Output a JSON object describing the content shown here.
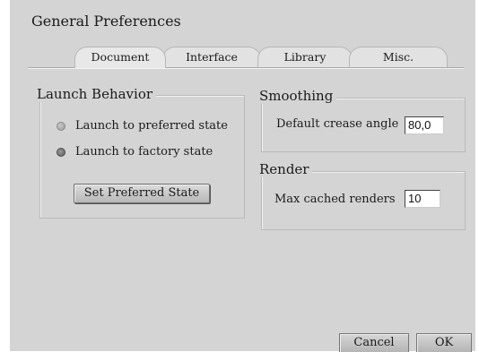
{
  "dialog": {
    "title": "General Preferences"
  },
  "tabs": [
    {
      "label": "Document",
      "active": true
    },
    {
      "label": "Interface",
      "active": false
    },
    {
      "label": "Library",
      "active": false
    },
    {
      "label": "Misc.",
      "active": false
    }
  ],
  "launch_behavior": {
    "title": "Launch Behavior",
    "options": [
      {
        "label": "Launch to preferred state",
        "selected": false
      },
      {
        "label": "Launch to factory state",
        "selected": true
      }
    ],
    "set_preferred_label": "Set Preferred State"
  },
  "smoothing": {
    "title": "Smoothing",
    "crease_label": "Default crease angle",
    "crease_value": "80,0"
  },
  "render": {
    "title": "Render",
    "cached_label": "Max cached renders",
    "cached_value": "10"
  },
  "footer": {
    "cancel_label": "Cancel",
    "ok_label": "OK"
  }
}
